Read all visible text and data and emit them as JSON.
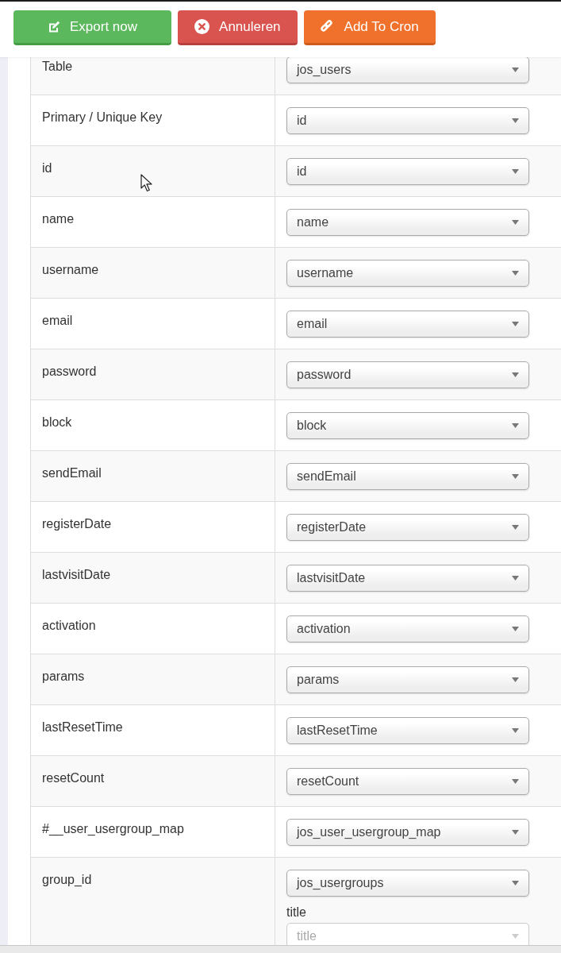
{
  "toolbar": {
    "buttons": [
      {
        "label": "Export now",
        "kind": "export"
      },
      {
        "label": "Annuleren",
        "kind": "cancel"
      },
      {
        "label": "Add To Cron",
        "kind": "cron"
      }
    ]
  },
  "mapping_table": {
    "rows": [
      {
        "label": "Table",
        "select": "jos_users"
      },
      {
        "label": "Primary / Unique Key",
        "select": "id"
      },
      {
        "label": "id",
        "select": "id"
      },
      {
        "label": "name",
        "select": "name"
      },
      {
        "label": "username",
        "select": "username"
      },
      {
        "label": "email",
        "select": "email"
      },
      {
        "label": "password",
        "select": "password"
      },
      {
        "label": "block",
        "select": "block"
      },
      {
        "label": "sendEmail",
        "select": "sendEmail"
      },
      {
        "label": "registerDate",
        "select": "registerDate"
      },
      {
        "label": "lastvisitDate",
        "select": "lastvisitDate"
      },
      {
        "label": "activation",
        "select": "activation"
      },
      {
        "label": "params",
        "select": "params"
      },
      {
        "label": "lastResetTime",
        "select": "lastResetTime"
      },
      {
        "label": "resetCount",
        "select": "resetCount"
      },
      {
        "label": "#__user_usergroup_map",
        "select": "jos_user_usergroup_map"
      },
      {
        "label": "group_id",
        "select": "jos_usergroups",
        "sub_fields": [
          {
            "label": "title",
            "placeholder": "title"
          }
        ]
      }
    ]
  }
}
